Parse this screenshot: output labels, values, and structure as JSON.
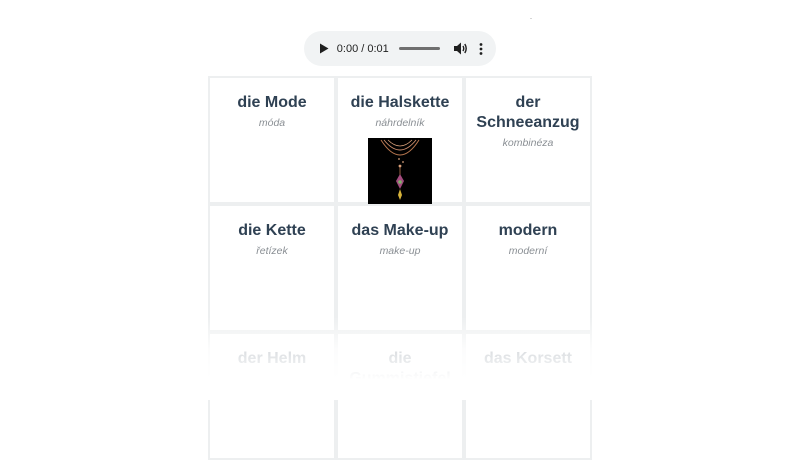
{
  "audio": {
    "time": "0:00 / 0:01",
    "icons": {
      "play": "play-icon",
      "volume": "volume-icon",
      "menu": "more-vert-icon"
    }
  },
  "cards": [
    {
      "word": "die Mode",
      "translation": "móda"
    },
    {
      "word": "die Halskette",
      "translation": "náhrdelník",
      "image": "necklace-image"
    },
    {
      "word": "der Schneeanzug",
      "translation": "kombinéza"
    },
    {
      "word": "die Kette",
      "translation": "řetízek"
    },
    {
      "word": "das Make-up",
      "translation": "make-up"
    },
    {
      "word": "modern",
      "translation": "moderní"
    },
    {
      "word": "der Helm",
      "translation": ""
    },
    {
      "word": "die Gummistiefel",
      "translation": ""
    },
    {
      "word": "das Korsett",
      "translation": ""
    }
  ],
  "colors": {
    "word": "#2f4153",
    "translation": "#8a8f94",
    "card_border": "#edeff0",
    "player_bg": "#f1f3f4"
  }
}
